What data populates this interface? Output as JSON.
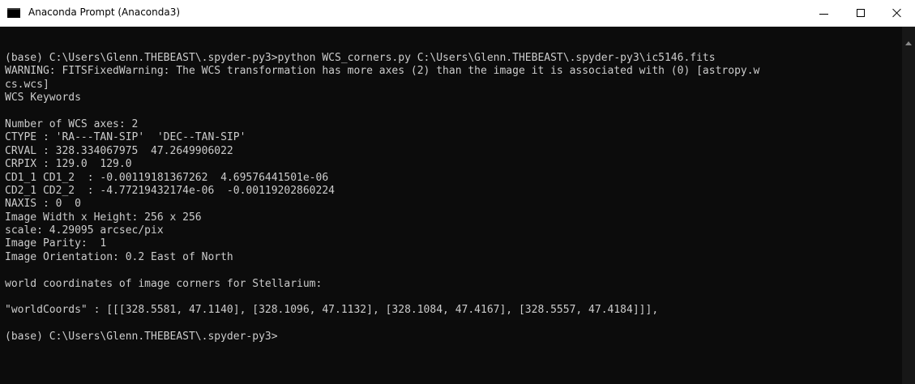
{
  "window": {
    "title": "Anaconda Prompt (Anaconda3)",
    "icon": "terminal-icon",
    "controls": {
      "minimize_icon": "minimize-icon",
      "maximize_icon": "maximize-icon",
      "close_icon": "close-icon"
    }
  },
  "colors": {
    "console_background": "#0c0c0c",
    "console_text": "#cccccc",
    "titlebar_background": "#ffffff"
  },
  "console": {
    "lines": [
      "(base) C:\\Users\\Glenn.THEBEAST\\.spyder-py3>python WCS_corners.py C:\\Users\\Glenn.THEBEAST\\.spyder-py3\\ic5146.fits",
      "WARNING: FITSFixedWarning: The WCS transformation has more axes (2) than the image it is associated with (0) [astropy.w",
      "cs.wcs]",
      "WCS Keywords",
      "",
      "Number of WCS axes: 2",
      "CTYPE : 'RA---TAN-SIP'  'DEC--TAN-SIP'",
      "CRVAL : 328.334067975  47.2649906022",
      "CRPIX : 129.0  129.0",
      "CD1_1 CD1_2  : -0.00119181367262  4.69576441501e-06",
      "CD2_1 CD2_2  : -4.77219432174e-06  -0.00119202860224",
      "NAXIS : 0  0",
      "Image Width x Height: 256 x 256",
      "scale: 4.29095 arcsec/pix",
      "Image Parity:  1",
      "Image Orientation: 0.2 East of North",
      "",
      "world coordinates of image corners for Stellarium:",
      "",
      "\"worldCoords\" : [[[328.5581, 47.1140], [328.1096, 47.1132], [328.1084, 47.4167], [328.5557, 47.4184]]],",
      "",
      "(base) C:\\Users\\Glenn.THEBEAST\\.spyder-py3>"
    ]
  }
}
